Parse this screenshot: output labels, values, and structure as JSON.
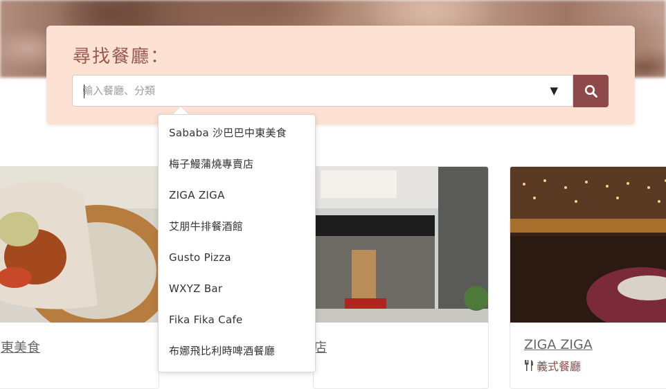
{
  "search": {
    "title": "尋找餐廳：",
    "placeholder": "輸入餐廳、分類",
    "dropdown_glyph": "▼"
  },
  "suggestions": [
    "Sababa 沙巴巴中東美食",
    "梅子鰻蒲燒專賣店",
    "ZIGA ZIGA",
    "艾朋牛排餐酒館",
    "Gusto Pizza",
    "WXYZ Bar",
    "Fika Fika Cafe",
    "布娜飛比利時啤酒餐廳"
  ],
  "cards": [
    {
      "title": "東美食",
      "category": ""
    },
    {
      "title": "店",
      "category": ""
    },
    {
      "title": "ZIGA ZIGA",
      "category": "義式餐廳"
    }
  ],
  "colors": {
    "panel_bg": "#fde1d3",
    "accent": "#8e4a4a",
    "title_text": "#9b5a50"
  },
  "icons": {
    "search_button": "search-icon",
    "category": "utensils-icon"
  }
}
